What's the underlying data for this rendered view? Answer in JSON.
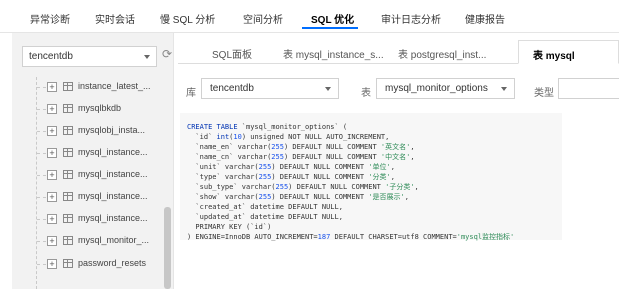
{
  "nav": {
    "tabs": [
      "异常诊断",
      "实时会话",
      "慢 SQL 分析",
      "空间分析",
      "SQL 优化",
      "审计日志分析",
      "健康报告"
    ],
    "active": "SQL 优化"
  },
  "sidebar": {
    "db_select": "tencentdb",
    "items": [
      "instance_latest_...",
      "mysqlbkdb",
      "mysqlobj_insta...",
      "mysql_instance...",
      "mysql_instance...",
      "mysql_instance...",
      "mysql_instance...",
      "mysql_monitor_...",
      "password_resets"
    ]
  },
  "editor_tabs": [
    "SQL面板",
    "表 mysql_instance_s...",
    "表 postgresql_inst...",
    "表 mysql"
  ],
  "filters": {
    "db_label": "库",
    "db_value": "tencentdb",
    "table_label": "表",
    "table_value": "mysql_monitor_options",
    "type_label": "类型"
  },
  "code": {
    "l1_kw": "CREATE TABLE",
    "l1_name": " `mysql_monitor_options` (",
    "rows": [
      {
        "a": "  `id` ",
        "b": "int",
        "c": "(",
        "n": "10",
        "d": ") unsigned NOT NULL AUTO_INCREMENT,"
      },
      {
        "a": "  `name_en` varchar(",
        "n": "255",
        "d": ") DEFAULT NULL COMMENT ",
        "s": "'英文名'",
        "e": ","
      },
      {
        "a": "  `name_cn` varchar(",
        "n": "255",
        "d": ") DEFAULT NULL COMMENT ",
        "s": "'中文名'",
        "e": ","
      },
      {
        "a": "  `unit` varchar(",
        "n": "255",
        "d": ") DEFAULT NULL COMMENT ",
        "s": "'单位'",
        "e": ","
      },
      {
        "a": "  `type` varchar(",
        "n": "255",
        "d": ") DEFAULT NULL COMMENT ",
        "s": "'分类'",
        "e": ","
      },
      {
        "a": "  `sub_type` varchar(",
        "n": "255",
        "d": ") DEFAULT NULL COMMENT ",
        "s": "'子分类'",
        "e": ","
      },
      {
        "a": "  `show` varchar(",
        "n": "255",
        "d": ") DEFAULT NULL COMMENT ",
        "s": "'是否展示'",
        "e": ","
      }
    ],
    "l9": "  `created_at` datetime DEFAULT NULL,",
    "l10": "  `updated_at` datetime DEFAULT NULL,",
    "l11": "  PRIMARY KEY (`id`)",
    "l12_a": ") ENGINE=InnoDB AUTO_INCREMENT=",
    "l12_n": "187",
    "l12_b": " DEFAULT CHARSET=utf8 COMMENT=",
    "l12_s": "'mysql监控指标'"
  }
}
